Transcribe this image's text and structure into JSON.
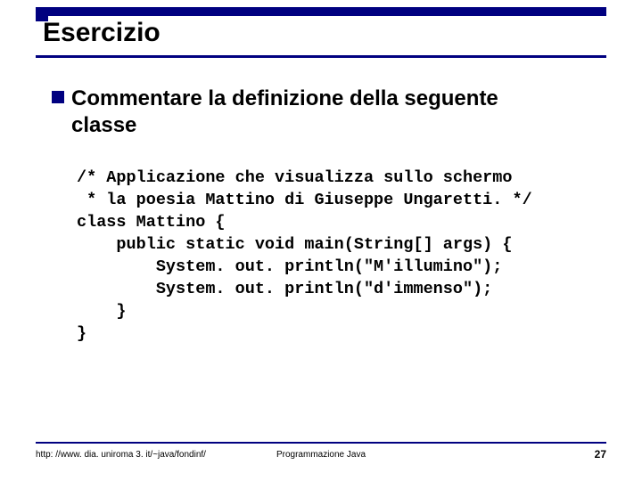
{
  "title": "Esercizio",
  "bullet": {
    "line1": "Commentare la definizione della seguente",
    "line2": "classe"
  },
  "code": {
    "l0": "/* Applicazione che visualizza sullo schermo",
    "l1": " * la poesia Mattino di Giuseppe Ungaretti. */",
    "l2": "class Mattino {",
    "l3": "    public static void main(String[] args) {",
    "l4": "        System. out. println(\"M'illumino\");",
    "l5": "        System. out. println(\"d'immenso\");",
    "l6": "    }",
    "l7": "}"
  },
  "footer": {
    "left": "http: //www. dia. uniroma 3. it/~java/fondinf/",
    "center": "Programmazione Java",
    "right": "27"
  }
}
